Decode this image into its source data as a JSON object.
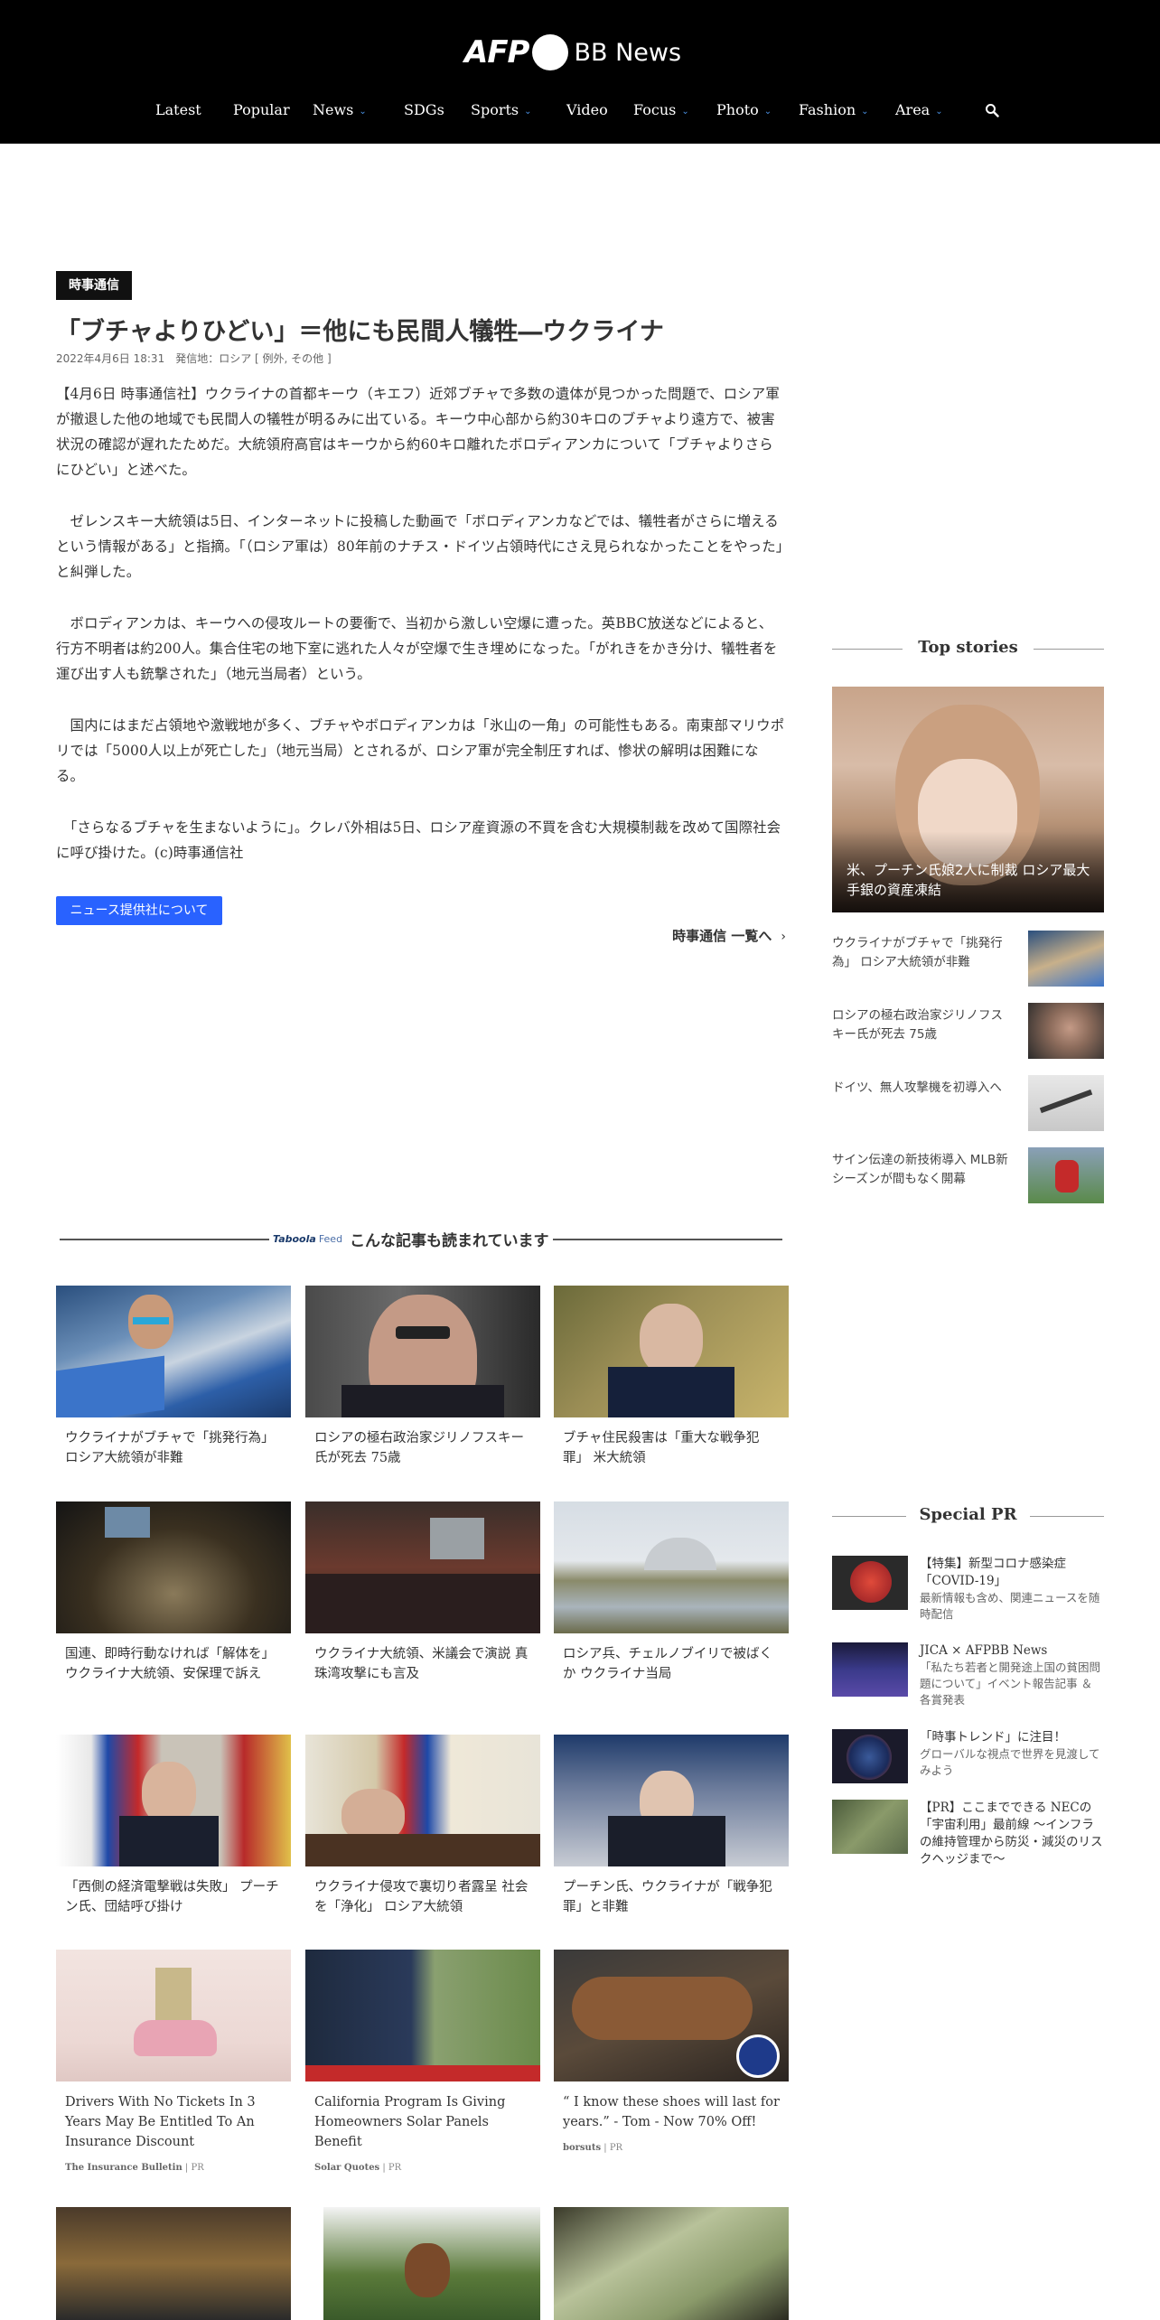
{
  "header": {
    "logo_afp": "AFP",
    "logo_bb": "BB News",
    "nav": [
      {
        "label": "Latest",
        "dropdown": false
      },
      {
        "label": "Popular",
        "dropdown": false
      },
      {
        "label": "News",
        "dropdown": true
      },
      {
        "label": "SDGs",
        "dropdown": false
      },
      {
        "label": "Sports",
        "dropdown": true
      },
      {
        "label": "Video",
        "dropdown": false
      },
      {
        "label": "Focus",
        "dropdown": true
      },
      {
        "label": "Photo",
        "dropdown": true
      },
      {
        "label": "Fashion",
        "dropdown": true
      },
      {
        "label": "Area",
        "dropdown": true
      }
    ],
    "chevron": "⌄",
    "search_icon": "search-icon"
  },
  "article": {
    "badge": "時事通信",
    "title": "「ブチャよりひどい」＝他にも民間人犠牲―ウクライナ",
    "dateline": "2022年4月6日 18:31　発信地：ロシア [ 例外, その他 ]",
    "paragraphs": [
      "【4月6日 時事通信社】ウクライナの首都キーウ（キエフ）近郊ブチャで多数の遺体が見つかった問題で、ロシア軍が撤退した他の地域でも民間人の犠牲が明るみに出ている。キーウ中心部から約30キロのブチャより遠方で、被害状況の確認が遅れたためだ。大統領府高官はキーウから約60キロ離れたボロディアンカについて「ブチャよりさらにひどい」と述べた。",
      "　ゼレンスキー大統領は5日、インターネットに投稿した動画で「ボロディアンカなどでは、犠牲者がさらに増えるという情報がある」と指摘。「（ロシア軍は）80年前のナチス・ドイツ占領時代にさえ見られなかったことをやった」と糾弾した。",
      "　ボロディアンカは、キーウへの侵攻ルートの要衝で、当初から激しい空爆に遭った。英BBC放送などによると、行方不明者は約200人。集合住宅の地下室に逃れた人々が空爆で生き埋めになった。「がれきをかき分け、犠牲者を運び出す人も銃撃された」（地元当局者）という。",
      "　国内にはまだ占領地や激戦地が多く、ブチャやボロディアンカは「氷山の一角」の可能性もある。南東部マリウポリでは「5000人以上が死亡した」（地元当局）とされるが、ロシア軍が完全制圧すれば、惨状の解明は困難になる。",
      "　「さらなるブチャを生まないように」。クレバ外相は5日、ロシア産資源の不買を含む大規模制裁を改めて国際社会に呼び掛けた。(c)時事通信社"
    ],
    "provider_button": "ニュース提供社について",
    "more_link": "時事通信 一覧へ",
    "more_arrow": "›"
  },
  "taboola": {
    "logo": "Taboola",
    "feed": "Feed",
    "title": "こんな記事も読まれています"
  },
  "cards": [
    {
      "title": "ウクライナがブチャで「挑発行為」 ロシア大統領が非難",
      "source": "",
      "pr": ""
    },
    {
      "title": "ロシアの極右政治家ジリノフスキー氏が死去 75歳",
      "source": "",
      "pr": ""
    },
    {
      "title": "ブチャ住民殺害は「重大な戦争犯罪」 米大統領",
      "source": "",
      "pr": ""
    },
    {
      "title": "国連、即時行動なければ「解体を」 ウクライナ大統領、安保理で訴え",
      "source": "",
      "pr": ""
    },
    {
      "title": "ウクライナ大統領、米議会で演説 真珠湾攻撃にも言及",
      "source": "",
      "pr": ""
    },
    {
      "title": "ロシア兵、チェルノブイリで被ばくか ウクライナ当局",
      "source": "",
      "pr": ""
    },
    {
      "title": "「西側の経済電撃戦は失敗」 プーチン氏、団結呼び掛け",
      "source": "",
      "pr": ""
    },
    {
      "title": "ウクライナ侵攻で裏切り者露呈 社会を「浄化」 ロシア大統領",
      "source": "",
      "pr": ""
    },
    {
      "title": "プーチン氏、ウクライナが「戦争犯罪」と非難",
      "source": "",
      "pr": ""
    },
    {
      "title": "Drivers With No Tickets In 3 Years May Be Entitled To An Insurance Discount",
      "source": "The Insurance Bulletin",
      "pr": "PR"
    },
    {
      "title": "California Program Is Giving Homeowners Solar Panels Benefit",
      "source": "Solar Quotes",
      "pr": "PR"
    },
    {
      "title": "“ I know these shoes will last for years.” - Tom - Now 70% Off!",
      "source": "borsuts",
      "pr": "PR"
    }
  ],
  "sidebar": {
    "top_stories_heading": "Top stories",
    "top_feature_title": "米、プーチン氏娘2人に制裁 ロシア最大手銀の資産凍結",
    "top_items": [
      "ウクライナがブチャで「挑発行為」 ロシア大統領が非難",
      "ロシアの極右政治家ジリノフスキー氏が死去 75歳",
      "ドイツ、無人攻撃機を初導入へ",
      "サイン伝達の新技術導入 MLB新シーズンが間もなく開幕"
    ],
    "special_pr_heading": "Special PR",
    "pr_items": [
      {
        "title": "【特集】新型コロナ感染症「COVID-19」",
        "desc": "最新情報も含め、関連ニュースを随時配信"
      },
      {
        "title": "JICA × AFPBB News",
        "desc": "「私たち若者と開発途上国の貧困問題について」イベント報告記事 ＆ 各賞発表"
      },
      {
        "title": "「時事トレンド」に注目！",
        "desc": "グローバルな視点で世界を見渡してみよう"
      },
      {
        "title": "【PR】ここまでできる NECの「宇宙利用」最前線 ～インフラの維持管理から防災・減災のリスクヘッジまで～",
        "desc": ""
      }
    ]
  },
  "colors": {
    "header_bg": "#000000",
    "accent_blue": "#2962ff",
    "chevron_blue": "#4a90e2"
  }
}
